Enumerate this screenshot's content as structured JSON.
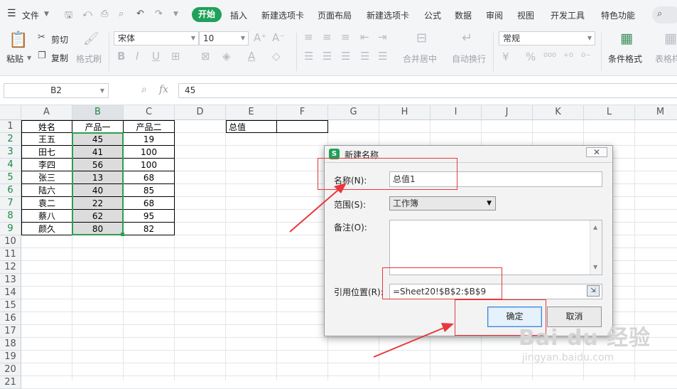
{
  "menubar": {
    "file_label": "文件",
    "tabs": [
      "开始",
      "插入",
      "新建选项卡",
      "页面布局",
      "新建选项卡",
      "公式",
      "数据",
      "审阅",
      "视图",
      "开发工具",
      "特色功能"
    ],
    "active_tab_index": 0
  },
  "ribbon": {
    "paste": "粘贴",
    "cut": "剪切",
    "copy": "复制",
    "format_painter": "格式刷",
    "font_name": "宋体",
    "font_size": "10",
    "merge_center": "合并居中",
    "auto_wrap": "自动换行",
    "number_format": "常规",
    "conditional_format": "条件格式",
    "table_style": "表格样"
  },
  "formula_bar": {
    "cell_ref": "B2",
    "fx_label": "fx",
    "value": "45"
  },
  "sheet": {
    "columns": [
      "A",
      "B",
      "C",
      "D",
      "E",
      "F",
      "G",
      "H",
      "I",
      "J",
      "K",
      "L",
      "M"
    ],
    "rows": [
      "1",
      "2",
      "3",
      "4",
      "5",
      "6",
      "7",
      "8",
      "9",
      "10",
      "11",
      "12",
      "13",
      "14",
      "15",
      "16",
      "17",
      "18",
      "19",
      "20",
      "21"
    ],
    "headers": [
      "姓名",
      "产品一",
      "产品二"
    ],
    "data": [
      [
        "王五",
        "45",
        "19"
      ],
      [
        "田七",
        "41",
        "100"
      ],
      [
        "李四",
        "56",
        "100"
      ],
      [
        "张三",
        "13",
        "68"
      ],
      [
        "陆六",
        "40",
        "85"
      ],
      [
        "袁二",
        "22",
        "68"
      ],
      [
        "蔡八",
        "62",
        "95"
      ],
      [
        "颜久",
        "80",
        "82"
      ]
    ],
    "e1_label": "总值",
    "selected_column": "B",
    "selected_rows": [
      "2",
      "3",
      "4",
      "5",
      "6",
      "7",
      "8",
      "9"
    ]
  },
  "dialog": {
    "title": "新建名称",
    "close": "✕",
    "name_label": "名称(N):",
    "name_value": "总值1",
    "scope_label": "范围(S):",
    "scope_value": "工作簿",
    "comment_label": "备注(O):",
    "ref_label": "引用位置(R):",
    "ref_value": "=Sheet20!$B$2:$B$9",
    "ok": "确定",
    "cancel": "取消"
  },
  "watermark": {
    "brand": "Bai du 经验",
    "url": "jingyan.baidu.com"
  },
  "colors": {
    "accent_green": "#1fa15a",
    "annotation_red": "#e8383c",
    "selection_green": "#2e9e4f"
  }
}
